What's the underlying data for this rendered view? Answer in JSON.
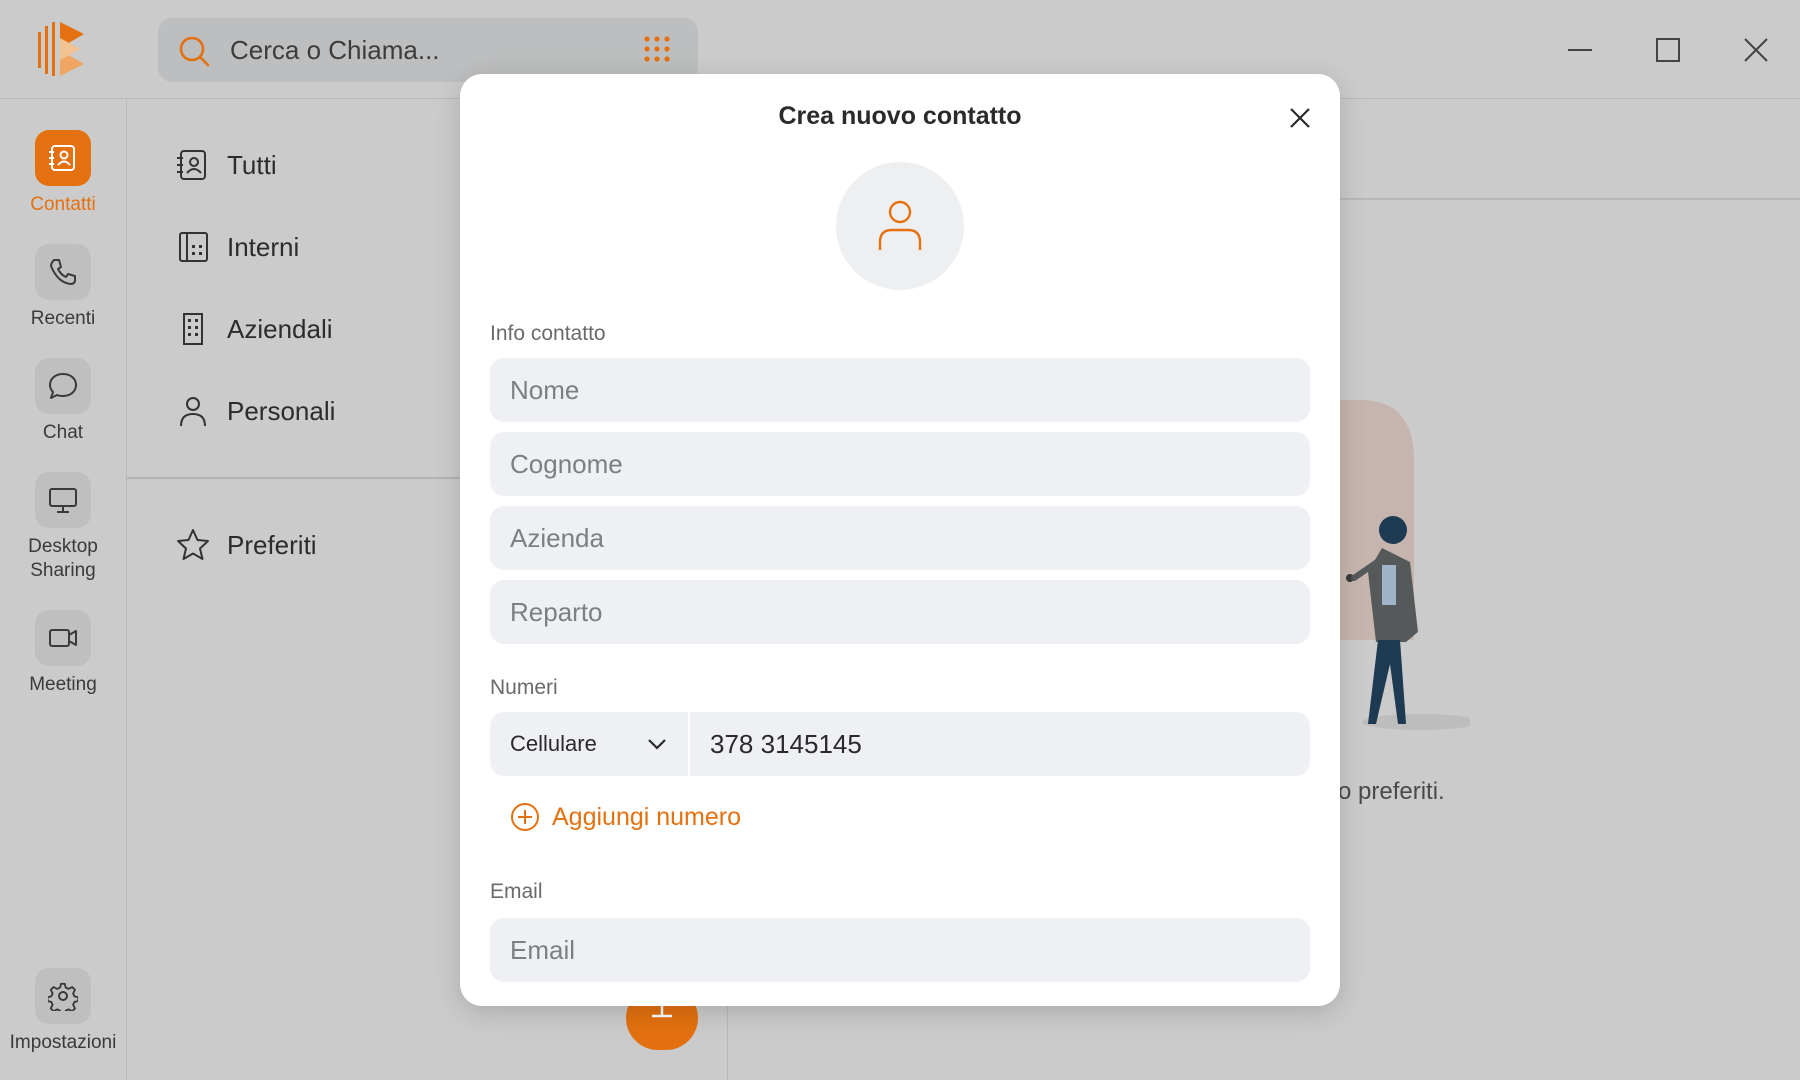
{
  "search": {
    "placeholder": "Cerca o Chiama..."
  },
  "colors": {
    "accent": "#e4700f",
    "field_bg": "#eef0f3"
  },
  "rail": {
    "items": [
      {
        "label": "Contatti",
        "icon": "contacts-book-icon",
        "active": true
      },
      {
        "label": "Recenti",
        "icon": "phone-icon"
      },
      {
        "label": "Chat",
        "icon": "chat-bubble-icon"
      },
      {
        "label": "Desktop Sharing",
        "icon": "monitor-icon"
      },
      {
        "label": "Meeting",
        "icon": "video-camera-icon"
      }
    ],
    "settings": {
      "label": "Impostazioni",
      "icon": "gear-icon"
    }
  },
  "categories": {
    "items": [
      {
        "label": "Tutti",
        "icon": "contacts-book-icon"
      },
      {
        "label": "Interni",
        "icon": "extension-grid-icon"
      },
      {
        "label": "Aziendali",
        "icon": "building-icon"
      },
      {
        "label": "Personali",
        "icon": "person-icon"
      }
    ],
    "favorites": {
      "label": "Preferiti",
      "icon": "star-icon"
    }
  },
  "empty_state": {
    "text": "o preferiti."
  },
  "modal": {
    "title": "Crea nuovo contatto",
    "info_section_label": "Info contatto",
    "fields": {
      "first_name": "Nome",
      "last_name": "Cognome",
      "company": "Azienda",
      "department": "Reparto"
    },
    "numbers_section_label": "Numeri",
    "phone": {
      "type": "Cellulare",
      "value": "378 3145145"
    },
    "add_number_label": "Aggiungi numero",
    "email_section_label": "Email",
    "email_placeholder": "Email"
  }
}
